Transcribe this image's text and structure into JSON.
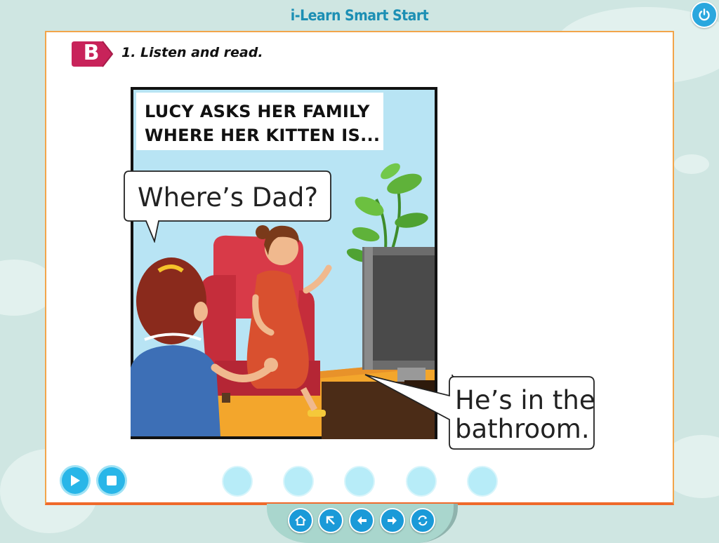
{
  "app": {
    "title": "i-Learn Smart Start"
  },
  "section": {
    "letter": "B",
    "instruction": "1. Listen and read."
  },
  "comic": {
    "caption_line1": "LUCY ASKS HER FAMILY",
    "caption_line2": "WHERE HER KITTEN IS...",
    "bubble_question": "Where’s Dad?",
    "bubble_answer_line1": "He’s in the",
    "bubble_answer_line2": "bathroom."
  },
  "controls": {
    "play_icon": "play-icon",
    "stop_icon": "stop-icon",
    "page_dots": 5
  },
  "nav": {
    "icons": [
      "home-icon",
      "back-up-icon",
      "previous-icon",
      "next-icon",
      "refresh-icon"
    ]
  },
  "colors": {
    "accent": "#1a9ad8",
    "panel_border": "#f2a54a",
    "badge": "#c8235a"
  }
}
